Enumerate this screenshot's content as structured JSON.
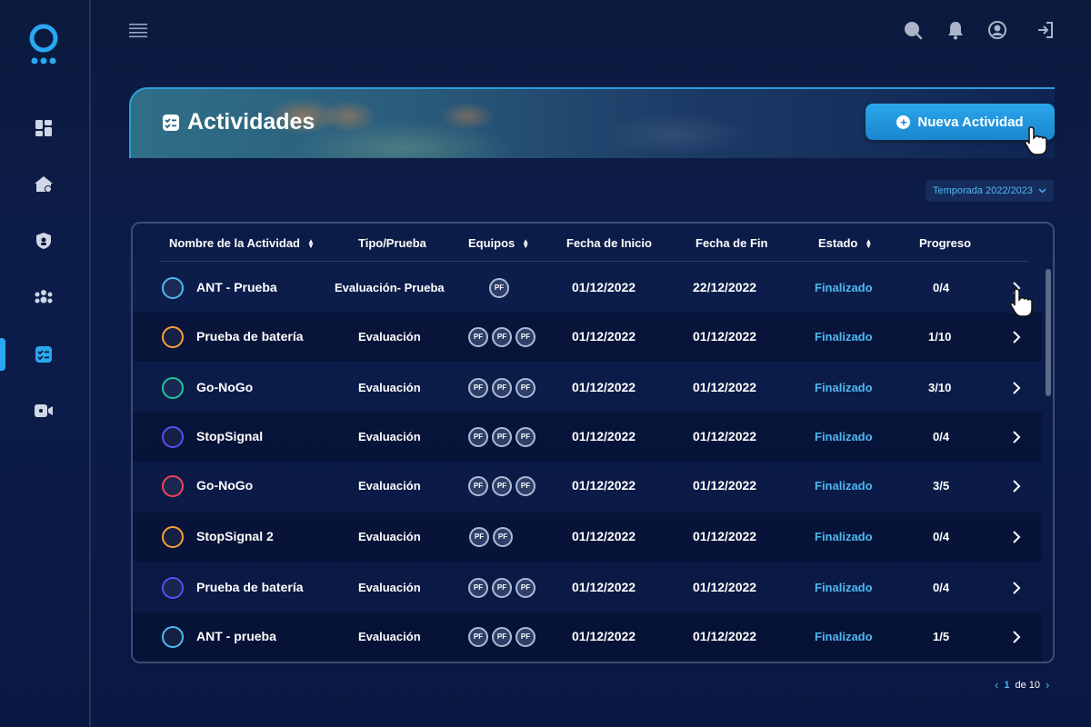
{
  "header": {
    "title": "Actividades",
    "new_button": "Nueva Actividad"
  },
  "season": {
    "selected": "Temporada 2022/2023"
  },
  "columns": {
    "name": "Nombre de la Actividad",
    "type": "Tipo/Prueba",
    "teams": "Equipos",
    "start": "Fecha de Inicio",
    "end": "Fecha de Fin",
    "state": "Estado",
    "progress": "Progreso"
  },
  "badge_label": "PF",
  "rows": [
    {
      "name": "ANT - Prueba",
      "type": "Evaluación- Prueba",
      "teams": 1,
      "start": "01/12/2022",
      "end": "22/12/2022",
      "state": "Finalizado",
      "progress": "0/4",
      "color": "#4fb8f0"
    },
    {
      "name": "Prueba de batería",
      "type": "Evaluación",
      "teams": 3,
      "start": "01/12/2022",
      "end": "01/12/2022",
      "state": "Finalizado",
      "progress": "1/10",
      "color": "#f5a03a"
    },
    {
      "name": "Go-NoGo",
      "type": "Evaluación",
      "teams": 3,
      "start": "01/12/2022",
      "end": "01/12/2022",
      "state": "Finalizado",
      "progress": "3/10",
      "color": "#27c39b"
    },
    {
      "name": "StopSignal",
      "type": "Evaluación",
      "teams": 3,
      "start": "01/12/2022",
      "end": "01/12/2022",
      "state": "Finalizado",
      "progress": "0/4",
      "color": "#5a4ef0"
    },
    {
      "name": "Go-NoGo",
      "type": "Evaluación",
      "teams": 3,
      "start": "01/12/2022",
      "end": "01/12/2022",
      "state": "Finalizado",
      "progress": "3/5",
      "color": "#f0445a"
    },
    {
      "name": "StopSignal 2",
      "type": "Evaluación",
      "teams": 2,
      "start": "01/12/2022",
      "end": "01/12/2022",
      "state": "Finalizado",
      "progress": "0/4",
      "color": "#f5a03a"
    },
    {
      "name": "Prueba de batería",
      "type": "Evaluación",
      "teams": 3,
      "start": "01/12/2022",
      "end": "01/12/2022",
      "state": "Finalizado",
      "progress": "0/4",
      "color": "#5a4ef0"
    },
    {
      "name": "ANT - prueba",
      "type": "Evaluación",
      "teams": 3,
      "start": "01/12/2022",
      "end": "01/12/2022",
      "state": "Finalizado",
      "progress": "1/5",
      "color": "#4fb8f0"
    }
  ],
  "pagination": {
    "current": "1",
    "separator": "de",
    "total": "10"
  },
  "colors": {
    "accent": "#29a8f0",
    "state": "#4fb8f0"
  },
  "icons": [
    "dashboard-icon",
    "home-icon",
    "shield-icon",
    "team-icon",
    "activities-icon",
    "video-icon",
    "menu-icon",
    "search-icon",
    "bell-icon",
    "user-icon",
    "logout-icon"
  ]
}
